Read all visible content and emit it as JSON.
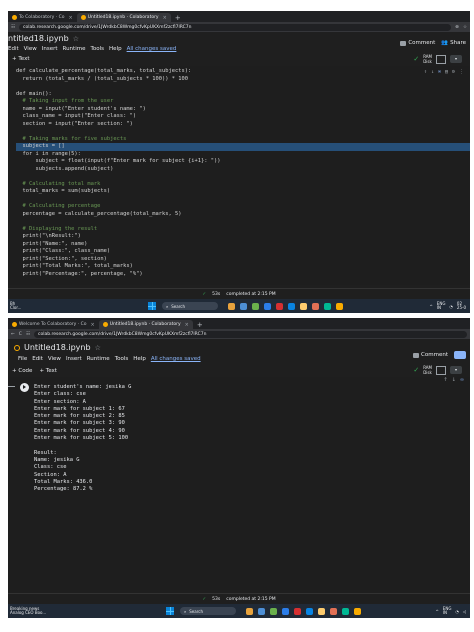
{
  "shot1": {
    "tabs": [
      {
        "label": "To Colaboratory · Co",
        "active": false
      },
      {
        "label": "Untitled18.ipynb · Colaboratory",
        "active": true
      }
    ],
    "url": "colab.research.google.com/drive/1JWrdkbC8Wmg0cfvKpUKXmf2zcfl7lRC7n",
    "notebook_title": "ntitled18.ipynb",
    "menu": [
      "Edit",
      "View",
      "Insert",
      "Runtime",
      "Tools",
      "Help"
    ],
    "changes_label": "All changes saved",
    "toolbar": [
      "+ Text"
    ],
    "comment_label": "Comment",
    "share_label": "Share",
    "ram_label": "RAM",
    "disk_label": "Disk",
    "code_lines": [
      {
        "text": "def calculate_percentage(total_marks, total_subjects):",
        "cls": ""
      },
      {
        "text": "  return (total_marks / (total_subjects * 100)) * 100",
        "cls": ""
      },
      {
        "text": "",
        "cls": ""
      },
      {
        "text": "def main():",
        "cls": ""
      },
      {
        "text": "  # Taking input from the user",
        "cls": "cm"
      },
      {
        "text": "  name = input(\"Enter student's name: \")",
        "cls": ""
      },
      {
        "text": "  class_name = input(\"Enter class: \")",
        "cls": ""
      },
      {
        "text": "  section = input(\"Enter section: \")",
        "cls": ""
      },
      {
        "text": "",
        "cls": ""
      },
      {
        "text": "  # Taking marks for five subjects",
        "cls": "cm"
      },
      {
        "text": "  subjects = []",
        "cls": "sel"
      },
      {
        "text": "  for i in range(5):",
        "cls": ""
      },
      {
        "text": "      subject = float(input(f\"Enter mark for subject {i+1}: \"))",
        "cls": ""
      },
      {
        "text": "      subjects.append(subject)",
        "cls": ""
      },
      {
        "text": "",
        "cls": ""
      },
      {
        "text": "  # Calculating total mark",
        "cls": "cm"
      },
      {
        "text": "  total_marks = sum(subjects)",
        "cls": ""
      },
      {
        "text": "",
        "cls": ""
      },
      {
        "text": "  # Calculating percentage",
        "cls": "cm"
      },
      {
        "text": "  percentage = calculate_percentage(total_marks, 5)",
        "cls": ""
      },
      {
        "text": "",
        "cls": ""
      },
      {
        "text": "  # Displaying the result",
        "cls": "cm"
      },
      {
        "text": "  print(\"\\nResult:\")",
        "cls": ""
      },
      {
        "text": "  print(\"Name:\", name)",
        "cls": ""
      },
      {
        "text": "  print(\"Class:\", class_name)",
        "cls": ""
      },
      {
        "text": "  print(\"Section:\", section)",
        "cls": ""
      },
      {
        "text": "  print(\"Total Marks:\", total_marks)",
        "cls": ""
      },
      {
        "text": "  print(\"Percentage:\", percentage, \"%\")",
        "cls": ""
      }
    ],
    "status_time": "53s",
    "status_text": "completed at 2:15 PM",
    "taskbar_left": "Bh\nClor...",
    "search_label": "Search",
    "tray_lang": "ENG\nIN",
    "tray_time": "02\n25-0"
  },
  "shot2": {
    "tabs": [
      {
        "label": "Welcome To Colaboratory · Co",
        "active": false
      },
      {
        "label": "Untitled18.ipynb · Colaboratory",
        "active": true
      }
    ],
    "url": "colab.research.google.com/drive/1JWrdkbC8Wmg0cfvKpUKXmf2zcfl7lRC7n",
    "notebook_title": "Untitled18.ipynb",
    "menu": [
      "File",
      "Edit",
      "View",
      "Insert",
      "Runtime",
      "Tools",
      "Help"
    ],
    "changes_label": "All changes saved",
    "toolbar": [
      "+ Code",
      "+ Text"
    ],
    "comment_label": "Comment",
    "ram_label": "RAM",
    "disk_label": "Disk",
    "output_lines": [
      "Enter student's name: jesika G",
      "Enter class: cse",
      "Enter section: A",
      "Enter mark for subject 1: 67",
      "Enter mark for subject 2: 85",
      "Enter mark for subject 3: 90",
      "Enter mark for subject 4: 90",
      "Enter mark for subject 5: 100",
      "",
      "Result:",
      "Name: jesika G",
      "Class: cse",
      "Section: A",
      "Total Marks: 436.0",
      "Percentage: 87.2 %"
    ],
    "status_time": "53s",
    "status_text": "completed at 2:15 PM",
    "taskbar_left": "Breaking news\nAnalog CEO Boo...",
    "search_label": "Search",
    "tray_lang": "ENG\nIN"
  }
}
